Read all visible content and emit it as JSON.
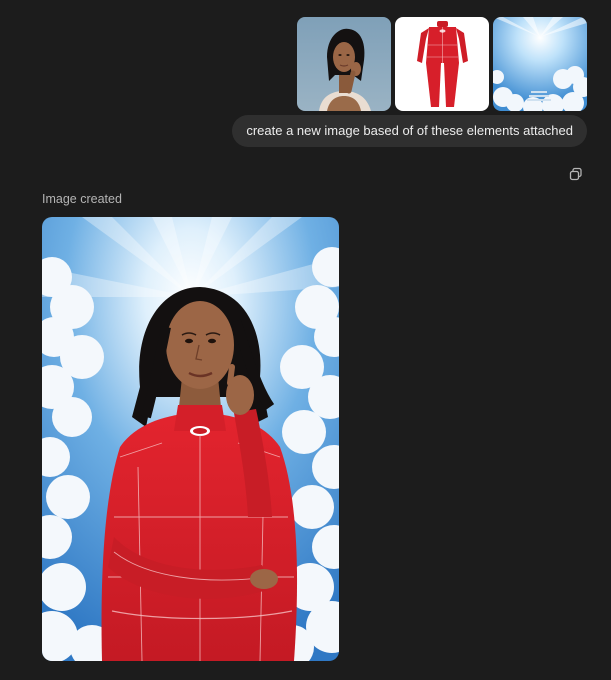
{
  "attachments": [
    {
      "name": "woman-portrait",
      "icon": "portrait-photo"
    },
    {
      "name": "red-racing-suit",
      "icon": "racing-suit-photo"
    },
    {
      "name": "sky-clouds",
      "icon": "sky-photo"
    }
  ],
  "message": {
    "prompt": "create a new image based of of these elements attached"
  },
  "response": {
    "status": "Image created",
    "copy_icon": "copy-icon"
  },
  "colors": {
    "background": "#1c1c1c",
    "bubble": "#2f2f2f",
    "text": "#ececec",
    "muted": "#b4b4b4",
    "suit_red": "#d71f2a"
  }
}
